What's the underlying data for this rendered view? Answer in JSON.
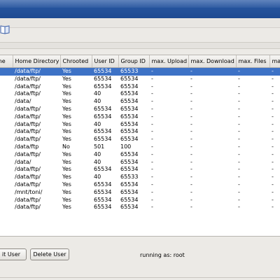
{
  "table": {
    "columns": [
      "me",
      "Home Directory",
      "Chrooted",
      "User ID",
      "Group ID",
      "max. Upload",
      "max. Download",
      "max. Files",
      "max"
    ],
    "rows": [
      [
        "",
        "/data/ftp/",
        "Yes",
        "65534",
        "65533",
        "-",
        "-",
        "-",
        "-"
      ],
      [
        "",
        "/data/ftp/",
        "Yes",
        "65534",
        "65534",
        "-",
        "-",
        "-",
        "-"
      ],
      [
        "",
        "/data/ftp/",
        "Yes",
        "65534",
        "65534",
        "-",
        "-",
        "-",
        "-"
      ],
      [
        "",
        "/data/ftp/",
        "Yes",
        "40",
        "65534",
        "-",
        "-",
        "-",
        "-"
      ],
      [
        "",
        "/data/",
        "Yes",
        "40",
        "65534",
        "-",
        "-",
        "-",
        "-"
      ],
      [
        "",
        "/data/ftp/",
        "Yes",
        "65534",
        "65534",
        "-",
        "-",
        "-",
        "-"
      ],
      [
        "",
        "/data/ftp/",
        "Yes",
        "65534",
        "65534",
        "-",
        "-",
        "-",
        "-"
      ],
      [
        "",
        "/data/ftp/",
        "Yes",
        "40",
        "65534",
        "-",
        "-",
        "-",
        "-"
      ],
      [
        "",
        "/data/ftp/",
        "Yes",
        "65534",
        "65534",
        "-",
        "-",
        "-",
        "-"
      ],
      [
        "",
        "/data/ftp/",
        "Yes",
        "65534",
        "65534",
        "-",
        "-",
        "-",
        "-"
      ],
      [
        "",
        "/data/ftp",
        "No",
        "501",
        "100",
        "-",
        "-",
        "-",
        "-"
      ],
      [
        "",
        "/data/ftp/",
        "Yes",
        "40",
        "65534",
        "-",
        "-",
        "-",
        "-"
      ],
      [
        "",
        "/data/",
        "Yes",
        "40",
        "65534",
        "-",
        "-",
        "-",
        "-"
      ],
      [
        "",
        "/data/ftp/",
        "Yes",
        "65534",
        "65534",
        "-",
        "-",
        "-",
        "-"
      ],
      [
        "",
        "/data/ftp/",
        "Yes",
        "40",
        "65533",
        "-",
        "-",
        "-",
        "-"
      ],
      [
        "",
        "/data/ftp/",
        "Yes",
        "65534",
        "65534",
        "-",
        "-",
        "-",
        "-"
      ],
      [
        "",
        "/mnt/toni/",
        "Yes",
        "65534",
        "65534",
        "-",
        "-",
        "-",
        "-"
      ],
      [
        "",
        "/data/ftp/",
        "Yes",
        "65534",
        "65534",
        "-",
        "-",
        "-",
        "-"
      ],
      [
        "",
        "/data/ftp/",
        "Yes",
        "65534",
        "65534",
        "-",
        "-",
        "-",
        "-"
      ]
    ],
    "selected_row": 0
  },
  "buttons": {
    "edit_user": "it User",
    "delete_user": "Delete User"
  },
  "status_text": "running as: root",
  "colors": {
    "titlebar": "#2a5aa6",
    "selection": "#3d72c6",
    "window_bg": "#eceae6"
  },
  "icons": {
    "toolbar": "book-icon"
  }
}
